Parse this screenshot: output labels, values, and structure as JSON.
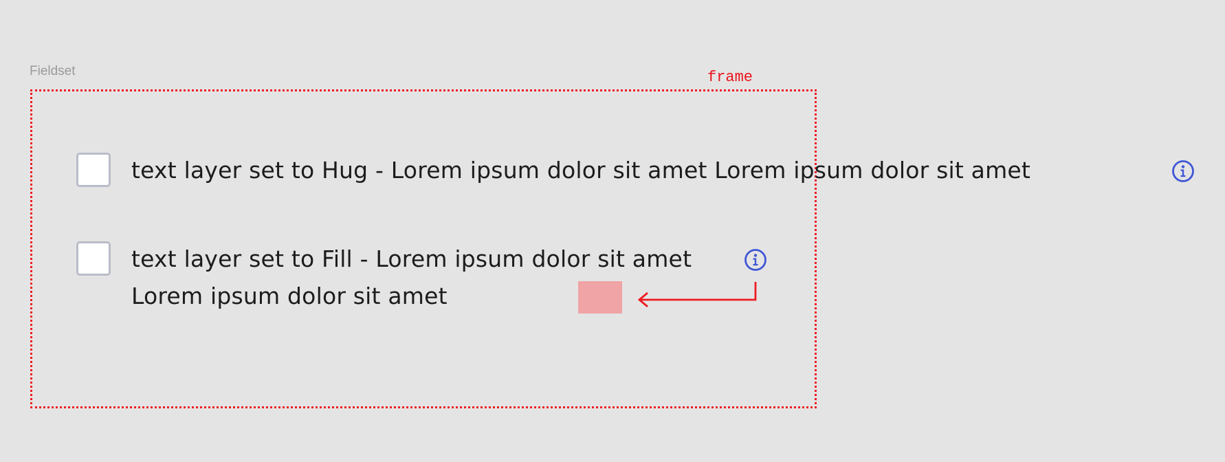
{
  "fieldset_label": "Fieldset",
  "frame_label": "frame",
  "rows": [
    {
      "text": "text layer set to Hug - Lorem ipsum dolor sit amet Lorem ipsum dolor sit amet",
      "checked": false,
      "icon": "info-icon"
    },
    {
      "text": "text layer set to Fill - Lorem ipsum dolor sit amet Lorem ipsum dolor sit amet",
      "checked": false,
      "icon": "info-icon"
    }
  ],
  "colors": {
    "background": "#e5e4e4",
    "frame_outline": "#ec1c24",
    "annotation_arrow": "#ec1c24",
    "info_icon": "#3f57d6",
    "swatch": "#f0a4a5",
    "checkbox_border": "#b9bcc9"
  }
}
